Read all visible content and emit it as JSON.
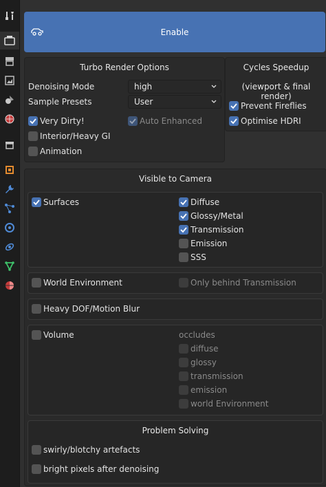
{
  "sidebar": {
    "icons": [
      "tool-icon",
      "render-icon",
      "output-icon",
      "view-layer-icon",
      "scene-icon",
      "world-icon",
      "collection-icon",
      "object-icon",
      "modifier-icon",
      "particles-icon",
      "physics-icon",
      "constraints-icon",
      "data-icon",
      "material-icon"
    ]
  },
  "enable_button": {
    "label": "Enable"
  },
  "turbo_render": {
    "title": "Turbo Render Options",
    "denoising_mode": {
      "label": "Denoising Mode",
      "value": "high"
    },
    "sample_presets": {
      "label": "Sample Presets",
      "value": "User"
    },
    "very_dirty": {
      "label": "Very Dirty!",
      "checked": true
    },
    "auto_enhanced": {
      "label": "Auto Enhanced",
      "checked": true
    },
    "interior_heavy_gi": {
      "label": "Interior/Heavy GI",
      "checked": false
    },
    "animation": {
      "label": "Animation",
      "checked": false
    }
  },
  "cycles_speedup": {
    "title": "Cycles Speedup",
    "subtitle": "(viewport & final render)",
    "prevent_fireflies": {
      "label": "Prevent Fireflies",
      "checked": true
    },
    "optimise_hdri": {
      "label": "Optimise HDRI",
      "checked": true
    }
  },
  "visible_to_camera": {
    "title": "Visible to Camera",
    "surfaces": {
      "label": "Surfaces",
      "checked": true
    },
    "diffuse": {
      "label": "Diffuse",
      "checked": true
    },
    "glossy_metal": {
      "label": "Glossy/Metal",
      "checked": true
    },
    "transmission": {
      "label": "Transmission",
      "checked": true
    },
    "emission": {
      "label": "Emission",
      "checked": false
    },
    "sss": {
      "label": "SSS",
      "checked": false
    },
    "world_environment": {
      "label": "World Environment",
      "checked": false
    },
    "only_behind_transmission": {
      "label": "Only behind Transmission",
      "checked": false
    },
    "heavy_dof": {
      "label": "Heavy DOF/Motion Blur",
      "checked": false
    },
    "volume": {
      "label": "Volume",
      "checked": false
    },
    "occludes": {
      "label": "occludes",
      "items": [
        "diffuse",
        "glossy",
        "transmission",
        "emission",
        "world Environment"
      ]
    }
  },
  "problem_solving": {
    "title": "Problem Solving",
    "swirly": {
      "label": "swirly/blotchy artefacts",
      "checked": false
    },
    "bright_pixels": {
      "label": "bright pixels after denoising",
      "checked": false
    }
  },
  "colors": {
    "accent": "#4772b3",
    "background": "#303030",
    "panel": "#2a2a2a"
  }
}
